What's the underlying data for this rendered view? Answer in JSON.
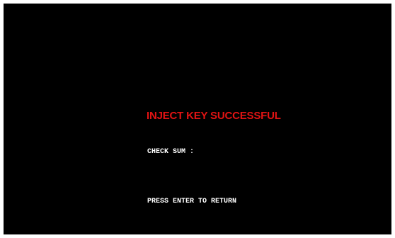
{
  "screen": {
    "title": "INJECT KEY SUCCESSFUL",
    "checksum_label": "CHECK SUM :",
    "checksum_value": "",
    "prompt": "PRESS ENTER TO RETURN"
  },
  "colors": {
    "background": "#000000",
    "title": "#e11313",
    "text": "#ffffff"
  }
}
